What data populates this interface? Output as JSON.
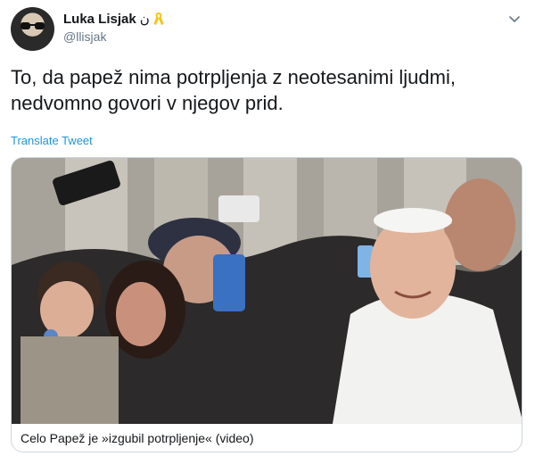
{
  "user": {
    "display_name": "Luka Lisjak",
    "name_suffix": "ن",
    "handle": "@llisjak"
  },
  "tweet": {
    "text": "To, da papež nima potrpljenja z neotesanimi ljudmi, nedvomno govori v njegov prid.",
    "translate_label": "Translate Tweet"
  },
  "card": {
    "caption": "Celo Papež je »izgubil potrpljenje« (video)"
  },
  "icons": {
    "ribbon": "yellow-ribbon-icon",
    "menu": "chevron-down-icon"
  },
  "colors": {
    "link": "#1b95e0",
    "secondary_text": "#657786",
    "ribbon": "#f5c518"
  }
}
